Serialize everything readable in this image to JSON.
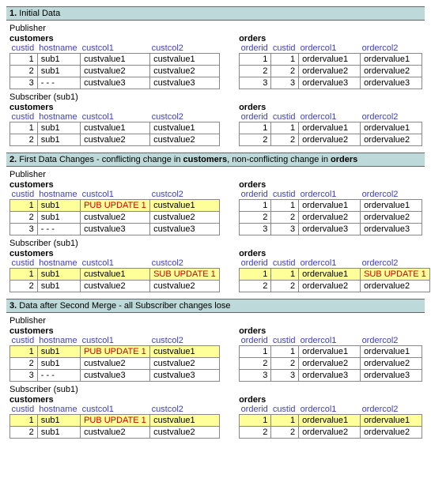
{
  "labels": {
    "customers": "customers",
    "orders": "orders",
    "publisher": "Publisher",
    "subscriber": "Subscriber (sub1)",
    "custHeaders": [
      "custid",
      "hostname",
      "custcol1",
      "custcol2"
    ],
    "ordHeaders": [
      "orderid",
      "custid",
      "ordercol1",
      "ordercol2"
    ]
  },
  "sections": [
    {
      "num": "1.",
      "title": "Initial Data",
      "titleHtml": "Initial Data",
      "blocks": [
        {
          "role": "publisher",
          "customers": [
            {
              "cells": [
                "1",
                "sub1",
                "custvalue1",
                "custvalue1"
              ]
            },
            {
              "cells": [
                "2",
                "sub1",
                "custvalue2",
                "custvalue2"
              ]
            },
            {
              "cells": [
                "3",
                "- - -",
                "custvalue3",
                "custvalue3"
              ]
            }
          ],
          "orders": [
            {
              "cells": [
                "1",
                "1",
                "ordervalue1",
                "ordervalue1"
              ]
            },
            {
              "cells": [
                "2",
                "2",
                "ordervalue2",
                "ordervalue2"
              ]
            },
            {
              "cells": [
                "3",
                "3",
                "ordervalue3",
                "ordervalue3"
              ]
            }
          ]
        },
        {
          "role": "subscriber",
          "customers": [
            {
              "cells": [
                "1",
                "sub1",
                "custvalue1",
                "custvalue1"
              ]
            },
            {
              "cells": [
                "2",
                "sub1",
                "custvalue2",
                "custvalue2"
              ]
            }
          ],
          "orders": [
            {
              "cells": [
                "1",
                "1",
                "ordervalue1",
                "ordervalue1"
              ]
            },
            {
              "cells": [
                "2",
                "2",
                "ordervalue2",
                "ordervalue2"
              ]
            }
          ]
        }
      ]
    },
    {
      "num": "2.",
      "title": "First Data Changes - conflicting change in customers, non-conflicting change in orders",
      "titleHtml": "First Data Changes - conflicting change in <b>customers</b>, non-conflicting change in <b>orders</b>",
      "blocks": [
        {
          "role": "publisher",
          "customers": [
            {
              "hl": true,
              "cells": [
                "1",
                "sub1",
                "PUB UPDATE 1",
                "custvalue1"
              ],
              "chg": [
                2
              ]
            },
            {
              "cells": [
                "2",
                "sub1",
                "custvalue2",
                "custvalue2"
              ]
            },
            {
              "cells": [
                "3",
                "- - -",
                "custvalue3",
                "custvalue3"
              ]
            }
          ],
          "orders": [
            {
              "cells": [
                "1",
                "1",
                "ordervalue1",
                "ordervalue1"
              ]
            },
            {
              "cells": [
                "2",
                "2",
                "ordervalue2",
                "ordervalue2"
              ]
            },
            {
              "cells": [
                "3",
                "3",
                "ordervalue3",
                "ordervalue3"
              ]
            }
          ]
        },
        {
          "role": "subscriber",
          "customers": [
            {
              "hl": true,
              "cells": [
                "1",
                "sub1",
                "custvalue1",
                "SUB UPDATE 1"
              ],
              "chg": [
                3
              ]
            },
            {
              "cells": [
                "2",
                "sub1",
                "custvalue2",
                "custvalue2"
              ]
            }
          ],
          "orders": [
            {
              "hl": true,
              "cells": [
                "1",
                "1",
                "ordervalue1",
                "SUB UPDATE 1"
              ],
              "chg": [
                3
              ]
            },
            {
              "cells": [
                "2",
                "2",
                "ordervalue2",
                "ordervalue2"
              ]
            }
          ]
        }
      ]
    },
    {
      "num": "3.",
      "title": "Data after Second Merge - all Subscriber changes lose",
      "titleHtml": "Data after Second Merge - all Subscriber changes lose",
      "blocks": [
        {
          "role": "publisher",
          "customers": [
            {
              "hl": true,
              "cells": [
                "1",
                "sub1",
                "PUB UPDATE 1",
                "custvalue1"
              ],
              "chg": [
                2
              ]
            },
            {
              "cells": [
                "2",
                "sub1",
                "custvalue2",
                "custvalue2"
              ]
            },
            {
              "cells": [
                "3",
                "- - -",
                "custvalue3",
                "custvalue3"
              ]
            }
          ],
          "orders": [
            {
              "cells": [
                "1",
                "1",
                "ordervalue1",
                "ordervalue1"
              ]
            },
            {
              "cells": [
                "2",
                "2",
                "ordervalue2",
                "ordervalue2"
              ]
            },
            {
              "cells": [
                "3",
                "3",
                "ordervalue3",
                "ordervalue3"
              ]
            }
          ]
        },
        {
          "role": "subscriber",
          "customers": [
            {
              "hl": true,
              "cells": [
                "1",
                "sub1",
                "PUB UPDATE 1",
                "custvalue1"
              ],
              "chg": [
                2
              ]
            },
            {
              "cells": [
                "2",
                "sub1",
                "custvalue2",
                "custvalue2"
              ]
            }
          ],
          "orders": [
            {
              "hl": true,
              "cells": [
                "1",
                "1",
                "ordervalue1",
                "ordervalue1"
              ]
            },
            {
              "cells": [
                "2",
                "2",
                "ordervalue2",
                "ordervalue2"
              ]
            }
          ]
        }
      ]
    }
  ]
}
